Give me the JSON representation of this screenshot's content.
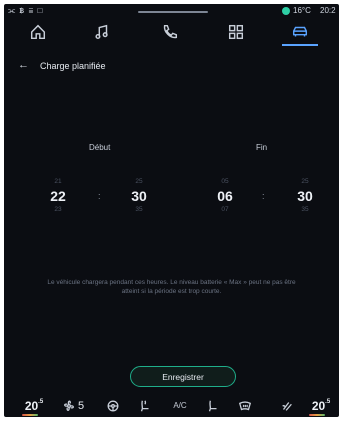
{
  "status_bar": {
    "left_icons": "⫘ ฿ ≣ □",
    "temperature": "16°C",
    "time": "20:2",
    "dot_color": "#2ecfa5"
  },
  "top_nav": {
    "items": [
      {
        "icon": "home-icon"
      },
      {
        "icon": "music-note-icon"
      },
      {
        "icon": "phone-icon"
      },
      {
        "icon": "apps-grid-icon"
      },
      {
        "icon": "car-icon",
        "active": true
      }
    ],
    "accent_color": "#5aa3ff"
  },
  "header": {
    "back_icon": "←",
    "title": "Charge planifiée"
  },
  "start": {
    "label": "Début",
    "hours": {
      "prev": "21",
      "current": "22",
      "next": "23"
    },
    "minutes": {
      "prev": "25",
      "current": "30",
      "next": "35"
    },
    "separator": ":"
  },
  "end": {
    "label": "Fin",
    "hours": {
      "prev": "05",
      "current": "06",
      "next": "07"
    },
    "minutes": {
      "prev": "25",
      "current": "30",
      "next": "35"
    },
    "separator": ":"
  },
  "info": {
    "line1": "Le véhicule chargera pendant ces heures. Le niveau batterie « Max » peut ne pas être",
    "line2": "atteint si la période est trop courte."
  },
  "save_button": {
    "label": "Enregistrer",
    "border_color": "#1fae8a"
  },
  "bottom_bar": {
    "left_temp": "20",
    "left_temp_unit": ".5",
    "fan_value": "5",
    "ac_label": "A/C",
    "right_temp": "20",
    "right_temp_unit": ".5"
  }
}
